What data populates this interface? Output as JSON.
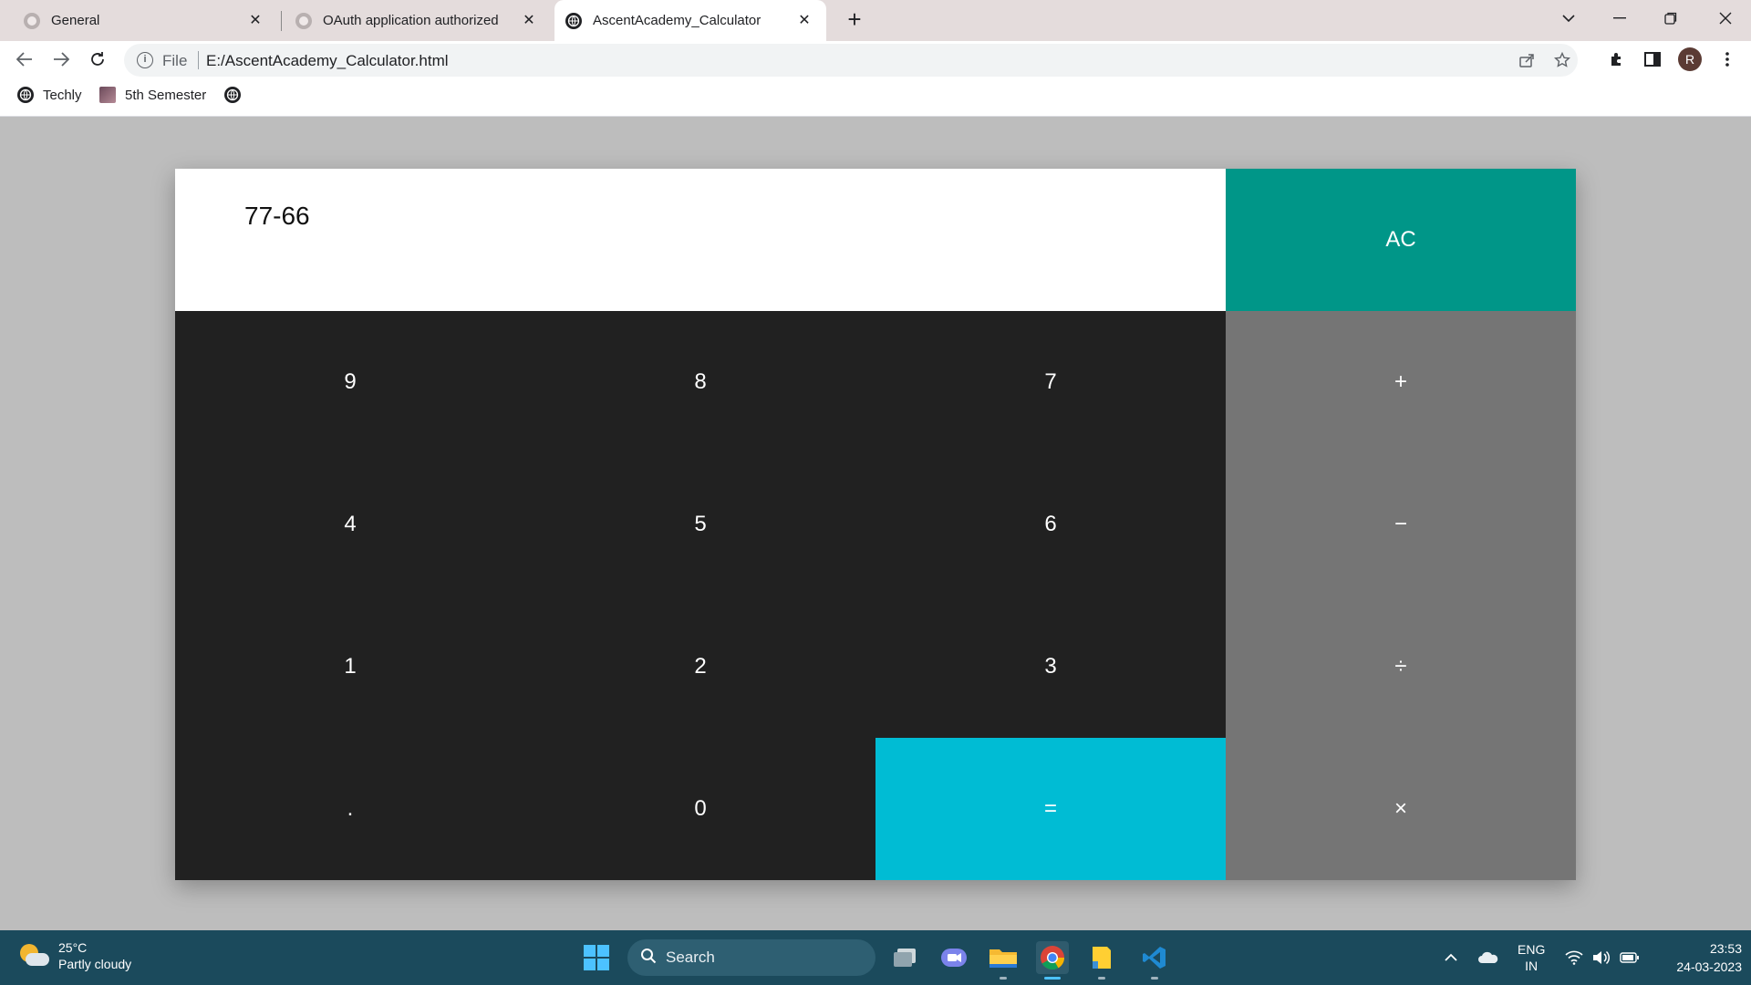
{
  "browser": {
    "tabs": [
      {
        "title": "General",
        "favicon": "github-icon"
      },
      {
        "title": "OAuth application authorized",
        "favicon": "github-icon"
      },
      {
        "title": "AscentAcademy_Calculator",
        "favicon": "globe-icon",
        "active": true
      }
    ],
    "new_tab_label": "+",
    "address": {
      "scheme": "File",
      "url": "E:/AscentAcademy_Calculator.html"
    },
    "profile_initial": "R",
    "bookmarks": [
      {
        "label": "Techly",
        "icon": "globe-icon"
      },
      {
        "label": "5th Semester",
        "icon": "photo-icon"
      },
      {
        "label": "",
        "icon": "globe-icon"
      }
    ]
  },
  "calculator": {
    "display": "77-66",
    "keys": {
      "ac": "AC",
      "nine": "9",
      "eight": "8",
      "seven": "7",
      "plus": "+",
      "four": "4",
      "five": "5",
      "six": "6",
      "minus": "−",
      "one": "1",
      "two": "2",
      "three": "3",
      "divide": "÷",
      "dot": ".",
      "zero": "0",
      "equals": "=",
      "multiply": "×"
    },
    "colors": {
      "display_bg": "#ffffff",
      "number_key_bg": "#212121",
      "operator_key_bg": "#757575",
      "clear_key_bg": "#009688",
      "equals_key_bg": "#00bcd4",
      "page_bg": "#bdbdbd"
    }
  },
  "taskbar": {
    "weather": {
      "temp": "25°C",
      "condition": "Partly cloudy"
    },
    "search_placeholder": "Search",
    "apps": [
      "task-view-icon",
      "teams-chat-icon",
      "file-explorer-icon",
      "chrome-icon",
      "sticky-notes-icon",
      "vscode-icon"
    ],
    "language": {
      "line1": "ENG",
      "line2": "IN"
    },
    "time": "23:53",
    "date": "24-03-2023"
  }
}
